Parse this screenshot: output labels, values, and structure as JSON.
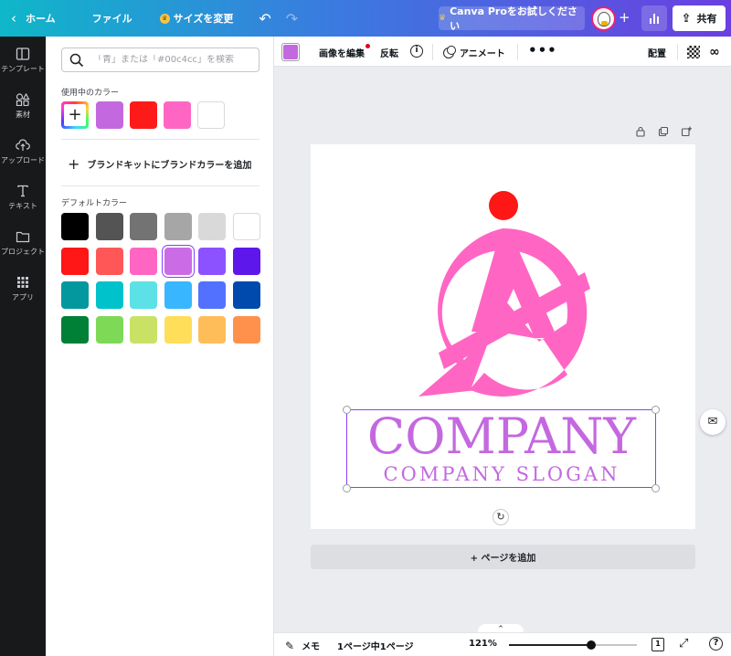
{
  "topbar": {
    "home_label": "ホーム",
    "file_label": "ファイル",
    "resize_label": "サイズを変更",
    "pro_label": "Canva Proをお試しください",
    "share_label": "共有"
  },
  "leftnav": {
    "items": [
      {
        "label": "テンプレート",
        "icon": "template-icon"
      },
      {
        "label": "素材",
        "icon": "elements-icon"
      },
      {
        "label": "アップロード",
        "icon": "upload-icon"
      },
      {
        "label": "テキスト",
        "icon": "text-icon"
      },
      {
        "label": "プロジェクト",
        "icon": "folder-icon"
      },
      {
        "label": "アプリ",
        "icon": "apps-icon"
      }
    ]
  },
  "panel": {
    "search_placeholder": "「青」または「#00c4cc」を検索",
    "used_title": "使用中のカラー",
    "used_colors": [
      "#c468e0",
      "#ff1a1a",
      "#ff66c4",
      "#ffffff"
    ],
    "brand_add_label": "ブランドキットにブランドカラーを追加",
    "default_title": "デフォルトカラー",
    "default_colors": [
      [
        "#000000",
        "#545454",
        "#737373",
        "#a6a6a6",
        "#d9d9d9",
        "#ffffff"
      ],
      [
        "#ff1616",
        "#ff5757",
        "#ff66c4",
        "#cb6ce6",
        "#8c52ff",
        "#5e17eb"
      ],
      [
        "#03989e",
        "#00c2cb",
        "#5ce1e6",
        "#38b6ff",
        "#5271ff",
        "#004aad"
      ],
      [
        "#008037",
        "#7ed957",
        "#c9e265",
        "#ffde59",
        "#ffbd59",
        "#ff914d"
      ]
    ],
    "selected_default": "#cb6ce6"
  },
  "toolbar": {
    "current_color": "#c468e0",
    "edit_image_label": "画像を編集",
    "flip_label": "反転",
    "animate_label": "アニメート",
    "position_label": "配置"
  },
  "canvas": {
    "company_text": "COMPANY",
    "slogan_text": "COMPANY SLOGAN",
    "add_page_label": "+ ページを追加",
    "logo_pink": "#ff66c4",
    "dot_red": "#ff1616",
    "text_color": "#c468e0"
  },
  "bottombar": {
    "memo_label": "メモ",
    "pages_label": "1ページ中1ページ",
    "zoom_label": "121%",
    "zoom_fraction": 0.64,
    "page_count": "1"
  }
}
